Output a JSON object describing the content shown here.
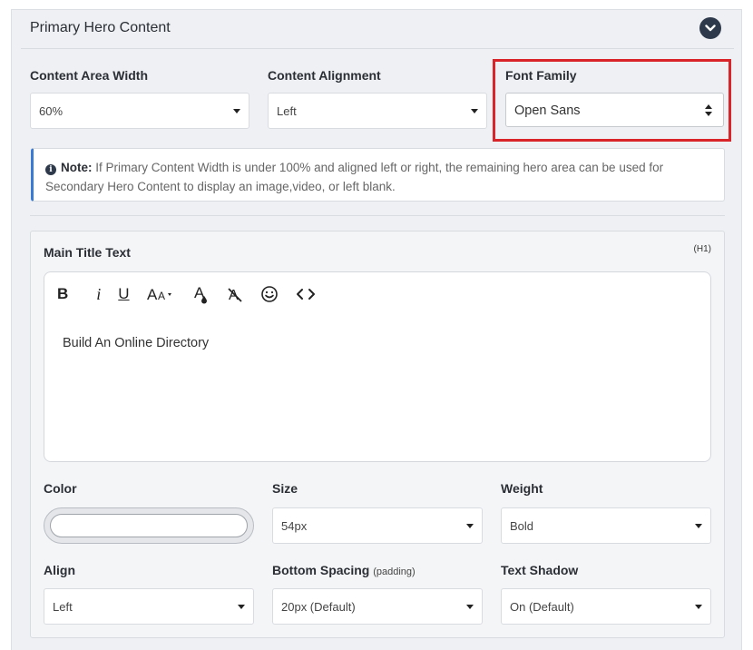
{
  "panel": {
    "title": "Primary Hero Content",
    "collapse_icon": "chevron-down-icon"
  },
  "layout_fields": {
    "content_area_width": {
      "label": "Content Area Width",
      "value": "60%"
    },
    "content_alignment": {
      "label": "Content Alignment",
      "value": "Left"
    },
    "font_family": {
      "label": "Font Family",
      "value": "Open Sans"
    }
  },
  "note": {
    "label": "Note:",
    "text": " If Primary Content Width is under 100% and aligned left or right, the remaining hero area can be used for Secondary Hero Content to display an image,video, or left blank."
  },
  "main_title": {
    "label": "Main Title Text",
    "tag": "(H1)",
    "toolbar": [
      {
        "name": "bold",
        "glyph": "B"
      },
      {
        "name": "italic",
        "glyph": "i"
      },
      {
        "name": "underline",
        "glyph": "U"
      },
      {
        "name": "font-size",
        "glyph": "AA▾"
      },
      {
        "name": "text-color",
        "glyph": "A"
      },
      {
        "name": "clear-format",
        "glyph": "A"
      },
      {
        "name": "emoji",
        "glyph": "☺"
      },
      {
        "name": "code-view",
        "glyph": "<>"
      }
    ],
    "content": "Build An Online Directory"
  },
  "style_fields": {
    "color": {
      "label": "Color",
      "value": ""
    },
    "size": {
      "label": "Size",
      "value": "54px"
    },
    "weight": {
      "label": "Weight",
      "value": "Bold"
    },
    "align": {
      "label": "Align",
      "value": "Left"
    },
    "bottom_spacing": {
      "label": "Bottom Spacing",
      "sublabel": "(padding)",
      "value": "20px (Default)"
    },
    "text_shadow": {
      "label": "Text Shadow",
      "value": "On (Default)"
    }
  },
  "colors": {
    "highlight_border": "#d9252a",
    "note_accent": "#3a7bd5",
    "panel_background": "#eef0f3",
    "dark_icon": "#2e3a4b"
  }
}
